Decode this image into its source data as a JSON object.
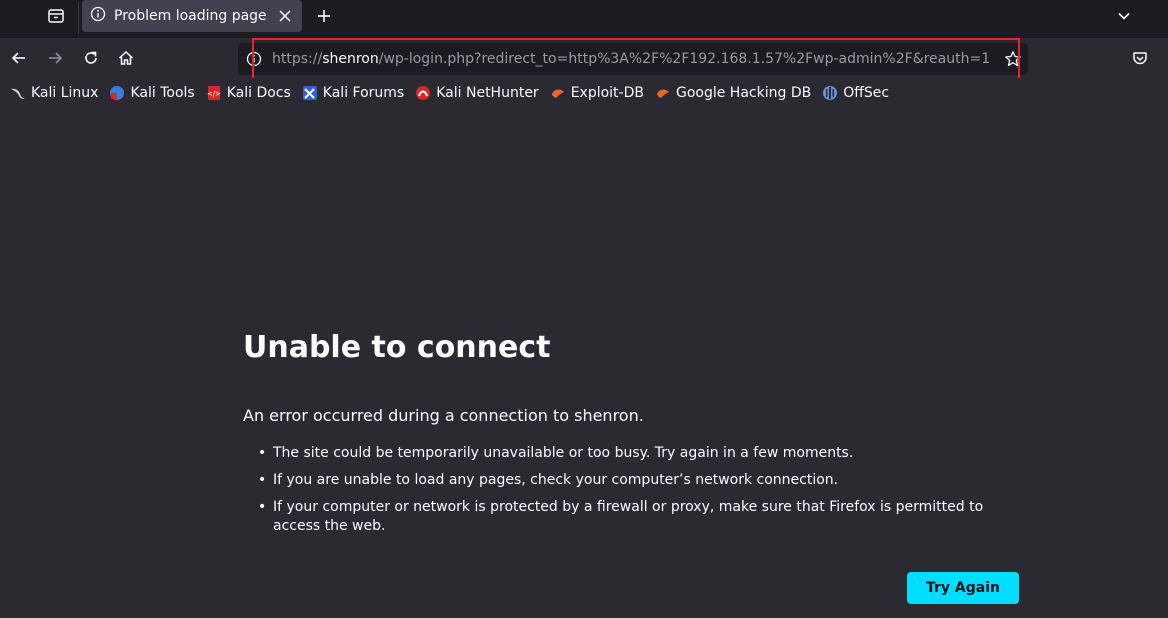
{
  "tab": {
    "title": "Problem loading page",
    "icon": "info-icon"
  },
  "urlbar": {
    "url_prefix": "https://",
    "url_host": "shenron",
    "url_path": "/wp-login.php?redirect_to=http%3A%2F%2F192.168.1.57%2Fwp-admin%2F&reauth=1"
  },
  "bookmarks": [
    {
      "label": "Kali Linux",
      "icon": "kali-linux-icon",
      "color": "#cfcfcf"
    },
    {
      "label": "Kali Tools",
      "icon": "kali-tools-icon",
      "color": "#3c7bd6"
    },
    {
      "label": "Kali Docs",
      "icon": "kali-docs-icon",
      "color": "#d8262a"
    },
    {
      "label": "Kali Forums",
      "icon": "kali-forums-icon",
      "color": "#2f63d1"
    },
    {
      "label": "Kali NetHunter",
      "icon": "kali-nethunter-icon",
      "color": "#d8262a"
    },
    {
      "label": "Exploit-DB",
      "icon": "exploit-db-icon",
      "color": "#e8662a"
    },
    {
      "label": "Google Hacking DB",
      "icon": "google-hacking-db-icon",
      "color": "#e8662a"
    },
    {
      "label": "OffSec",
      "icon": "offsec-icon",
      "color": "#6b8de0"
    }
  ],
  "error": {
    "title": "Unable to connect",
    "description": "An error occurred during a connection to shenron.",
    "items": [
      "The site could be temporarily unavailable or too busy. Try again in a few moments.",
      "If you are unable to load any pages, check your computer’s network connection.",
      "If your computer or network is protected by a firewall or proxy, make sure that Firefox is permitted to access the web."
    ],
    "button_label": "Try Again"
  },
  "colors": {
    "accent": "#00ddff",
    "highlight": "#e3262d",
    "background": "#2b2a33"
  }
}
